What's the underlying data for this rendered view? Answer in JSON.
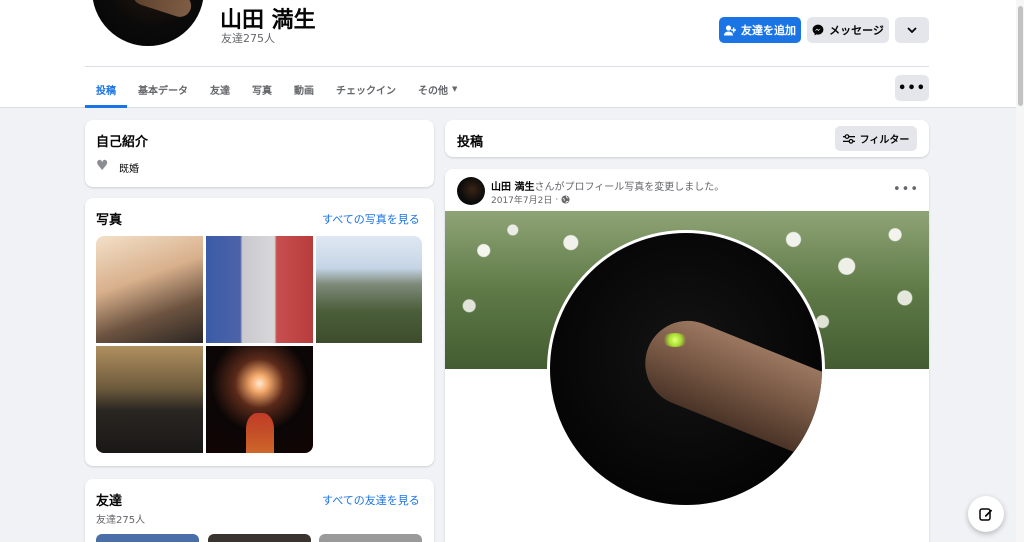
{
  "profile": {
    "name": "山田 満生",
    "friend_count": "友達275人"
  },
  "actions": {
    "add_friend": "友達を追加",
    "message": "メッセージ"
  },
  "tabs": [
    {
      "label": "投稿",
      "active": true
    },
    {
      "label": "基本データ"
    },
    {
      "label": "友達"
    },
    {
      "label": "写真"
    },
    {
      "label": "動画"
    },
    {
      "label": "チェックイン"
    },
    {
      "label": "その他"
    }
  ],
  "intro": {
    "title": "自己紹介",
    "relationship": "既婚"
  },
  "photos": {
    "title": "写真",
    "see_all": "すべての写真を見る"
  },
  "friends": {
    "title": "友達",
    "subtitle": "友達275人",
    "see_all": "すべての友達を見る"
  },
  "posts": {
    "title": "投稿",
    "filter_label": "フィルター"
  },
  "post": {
    "author": "山田 満生",
    "action_text": "さんがプロフィール写真を変更しました。",
    "date": "2017年7月2日",
    "separator": "·"
  },
  "colors": {
    "accent": "#1b74e4",
    "background": "#f0f2f5"
  }
}
